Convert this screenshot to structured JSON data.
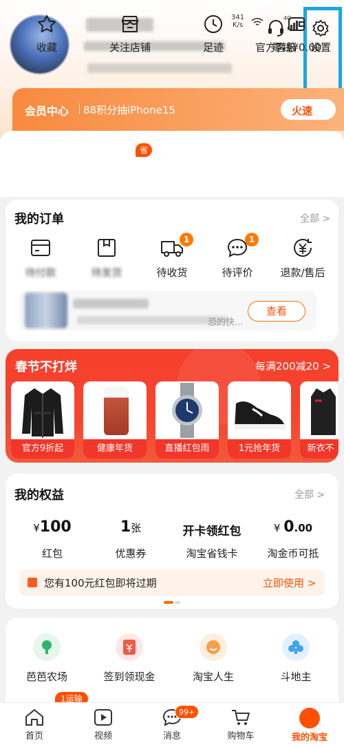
{
  "status": {
    "speed": "341",
    "speed_unit": "K/s",
    "net1": "4G",
    "net2": "4G"
  },
  "header": {
    "service_label": "官方客服",
    "settings_label": "设置"
  },
  "vip": {
    "title": "会员中心",
    "subtitle": "88积分抽iPhone15",
    "button": "火速"
  },
  "quick": {
    "items": [
      {
        "label": "收藏",
        "icon": "star-icon"
      },
      {
        "label": "关注店铺",
        "icon": "shop-icon"
      },
      {
        "label": "足迹",
        "icon": "clock-icon"
      },
      {
        "label": "零钱¥0.00",
        "icon": "wallet-icon"
      }
    ],
    "shop_badge": "省"
  },
  "orders": {
    "title": "我的订单",
    "all_label": "全部 >",
    "items": [
      {
        "label": "待付款",
        "icon": "card-icon"
      },
      {
        "label": "待发货",
        "icon": "box-icon"
      },
      {
        "label": "待收货",
        "icon": "truck-icon",
        "badge": "1"
      },
      {
        "label": "待评价",
        "icon": "comment-icon",
        "badge": "1"
      },
      {
        "label": "退款/售后",
        "icon": "refund-icon"
      }
    ],
    "tracking": {
      "text": "恐的快...",
      "button": "查看"
    }
  },
  "spring": {
    "title": "春节不打烊",
    "promo": "每满200减20 >",
    "products": [
      {
        "label": "官方9折起"
      },
      {
        "label": "健康年货"
      },
      {
        "label": "直播红包雨"
      },
      {
        "label": "1元抢年货"
      },
      {
        "label": "新衣不"
      }
    ]
  },
  "benefits": {
    "title": "我的权益",
    "all_label": "全部 >",
    "items": [
      {
        "prefix": "¥",
        "value": "100",
        "suffix": "",
        "label": "红包"
      },
      {
        "prefix": "",
        "value": "1",
        "suffix": "张",
        "label": "优惠券"
      },
      {
        "prefix": "",
        "value": "开卡领红包",
        "suffix": "",
        "label": "淘宝省钱卡"
      },
      {
        "prefix": "¥ ",
        "value": "0",
        "suffix": ".00",
        "label": "淘金币可抵"
      }
    ],
    "notice": {
      "text": "您有100元红包即将过期",
      "action": "立即使用 >"
    }
  },
  "games": {
    "items": [
      {
        "label": "芭芭农场",
        "color": "#2fb36b"
      },
      {
        "label": "签到领现金",
        "color": "#f05a4a"
      },
      {
        "label": "淘宝人生",
        "color": "#f5a04a"
      },
      {
        "label": "斗地主",
        "color": "#3fa3f0"
      }
    ],
    "badge": "1运输"
  },
  "tabbar": {
    "items": [
      {
        "label": "首页"
      },
      {
        "label": "视频"
      },
      {
        "label": "消息",
        "badge": "99+"
      },
      {
        "label": "购物车"
      },
      {
        "label": "我的淘宝"
      }
    ]
  },
  "colors": {
    "accent": "#ff5000",
    "highlight": "#1aa6e6",
    "spring_bg": "#f5402c"
  }
}
